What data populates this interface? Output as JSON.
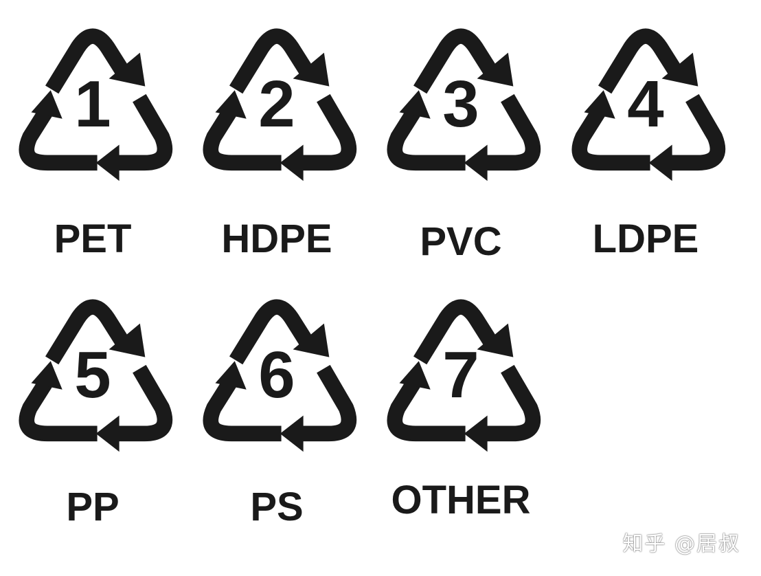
{
  "ink_color": "#1a1a1a",
  "background_color": "#ffffff",
  "symbols": [
    {
      "number": "1",
      "code": "PET"
    },
    {
      "number": "2",
      "code": "HDPE"
    },
    {
      "number": "3",
      "code": "PVC"
    },
    {
      "number": "4",
      "code": "LDPE"
    },
    {
      "number": "5",
      "code": "PP"
    },
    {
      "number": "6",
      "code": "PS"
    },
    {
      "number": "7",
      "code": "OTHER"
    }
  ],
  "watermark": "知乎 @居叔"
}
